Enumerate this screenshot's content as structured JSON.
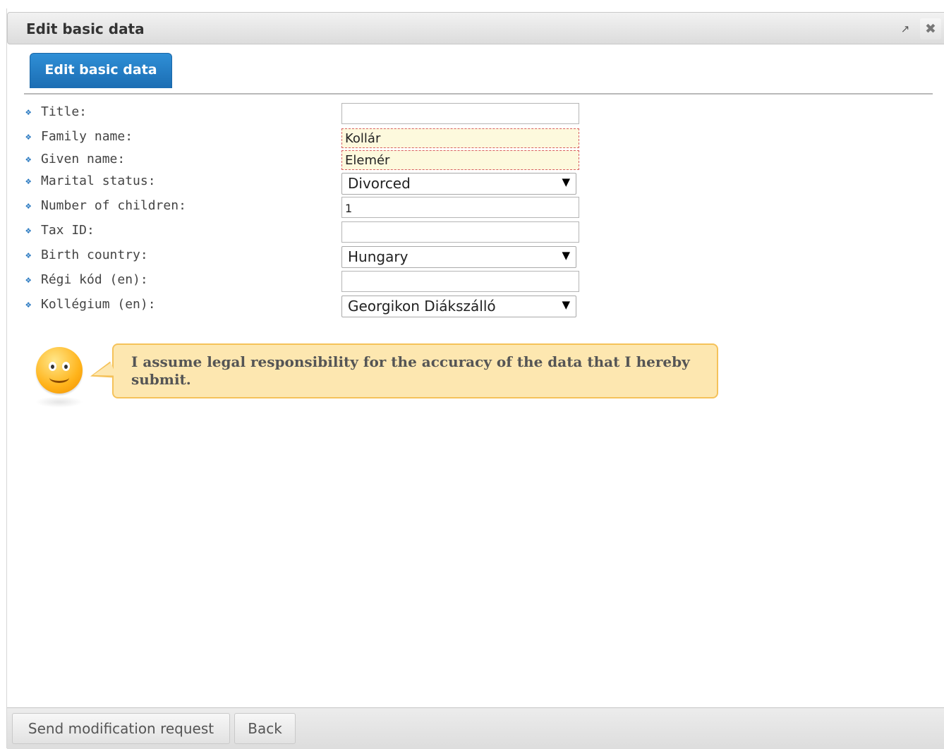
{
  "window": {
    "title": "Edit basic data",
    "popout_icon": "↗",
    "close_icon": "✖"
  },
  "tabs": [
    {
      "label": "Edit basic data",
      "active": true
    }
  ],
  "form": {
    "title": {
      "label": "Title:",
      "value": ""
    },
    "family_name": {
      "label": "Family name:",
      "value": "Kollár"
    },
    "given_name": {
      "label": "Given name:",
      "value": "Elemér"
    },
    "marital_status": {
      "label": "Marital status:",
      "value": "Divorced"
    },
    "children": {
      "label": "Number of children:",
      "value": "1"
    },
    "tax_id": {
      "label": "Tax ID:",
      "value": ""
    },
    "birth_country": {
      "label": "Birth country:",
      "value": "Hungary"
    },
    "regi_kod": {
      "label": "Régi kód (en):",
      "value": ""
    },
    "kollegium": {
      "label": "Kollégium (en):",
      "value": "Georgikon Diákszálló"
    }
  },
  "notice": {
    "text": "I assume legal responsibility for the accuracy of the data that I hereby submit."
  },
  "footer": {
    "send_label": "Send modification request",
    "back_label": "Back"
  },
  "colors": {
    "accent": "#1b6db3",
    "required_bg": "#fdf9dd",
    "required_border": "#d86060",
    "notice_bg": "#fde7b0",
    "notice_border": "#f5c25a"
  }
}
